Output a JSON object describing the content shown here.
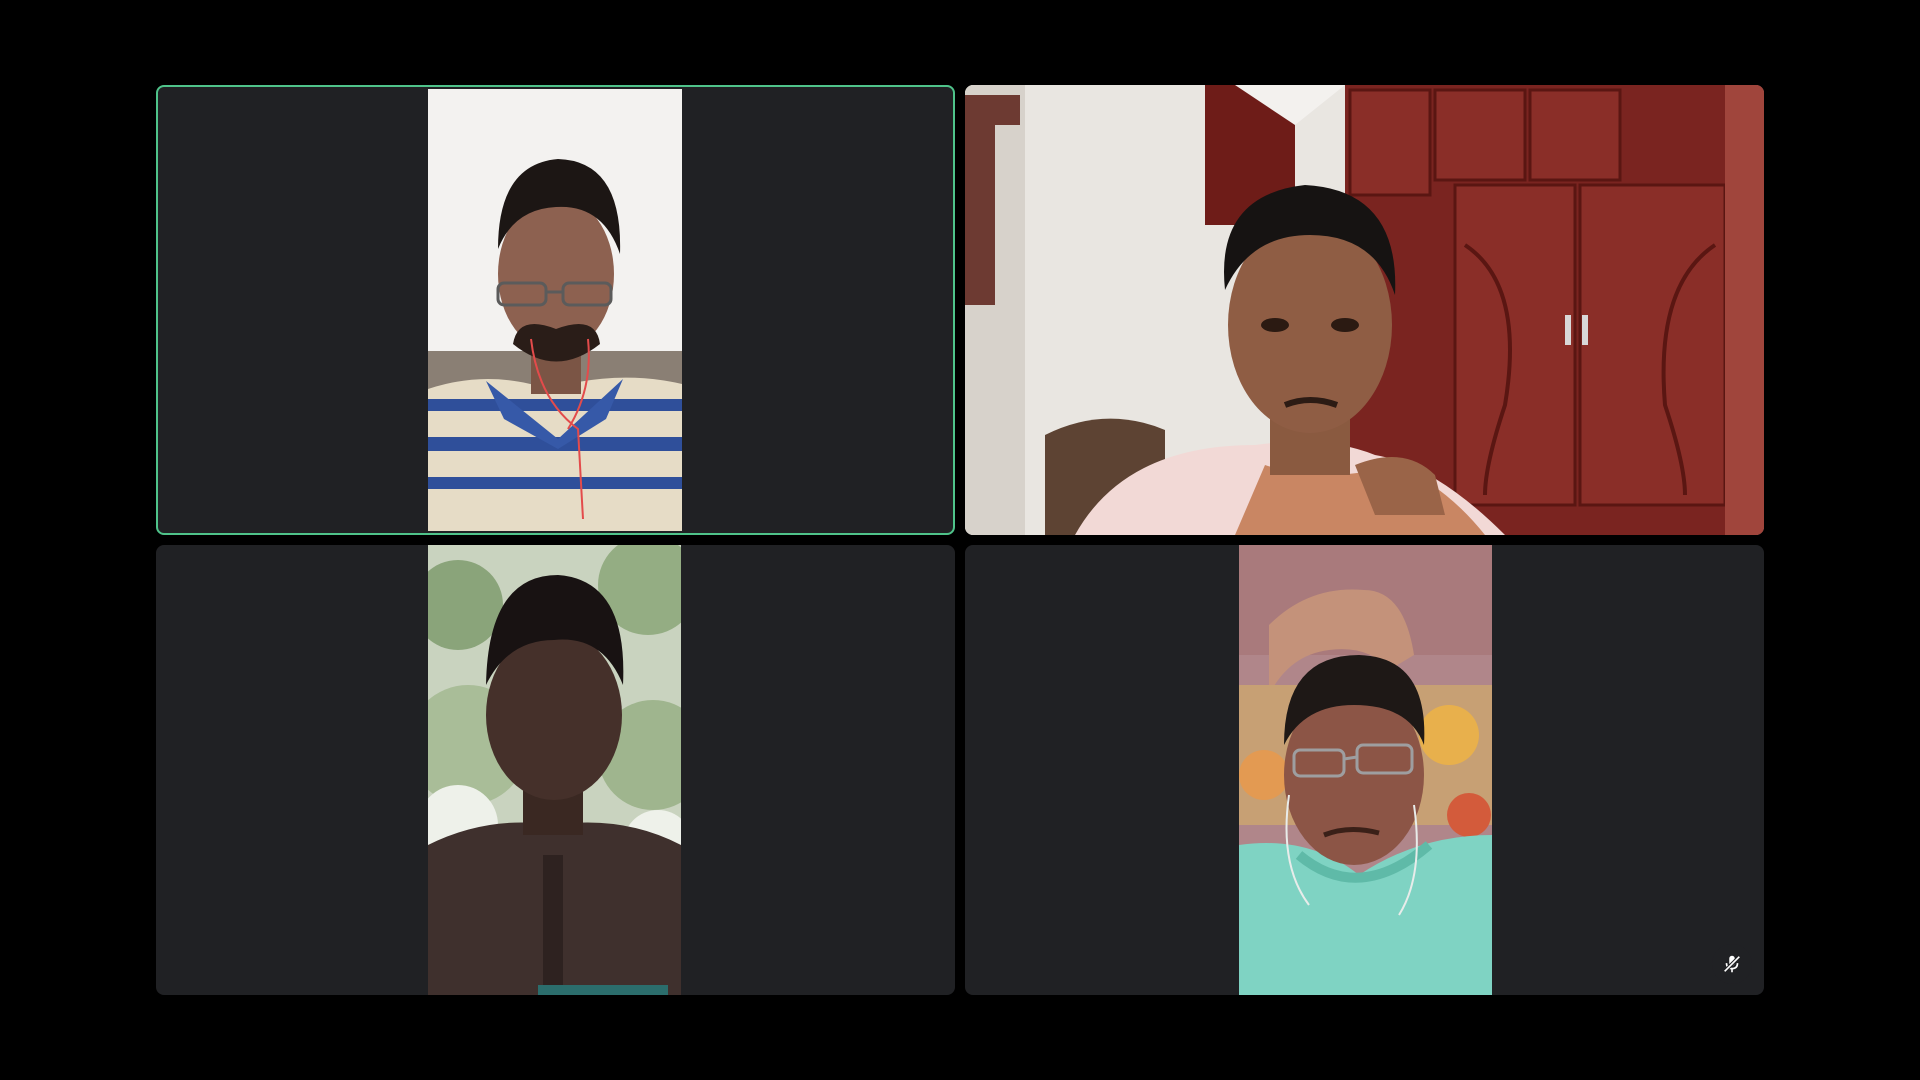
{
  "meeting": {
    "participants": [
      {
        "tile": "participant-1",
        "speaking": true,
        "muted": false
      },
      {
        "tile": "participant-2",
        "speaking": false,
        "muted": false
      },
      {
        "tile": "participant-3",
        "speaking": false,
        "muted": false
      },
      {
        "tile": "participant-4",
        "speaking": false,
        "muted": true
      }
    ],
    "colors": {
      "background": "#000000",
      "tile": "#202124",
      "active_speaker_border": "#4fc38a"
    },
    "icons": {
      "mute": "mic-off-icon"
    }
  }
}
